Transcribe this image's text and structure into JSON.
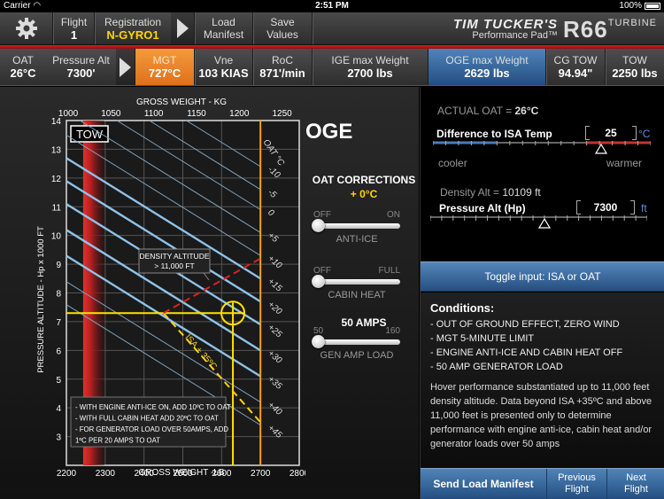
{
  "status_bar": {
    "carrier": "Carrier",
    "time": "2:51 PM",
    "battery": "100%"
  },
  "top_bar": {
    "flight_label": "Flight",
    "flight_value": "1",
    "registration_label": "Registration",
    "registration_value": "N-GYRO1",
    "load_manifest": "Load\nManifest",
    "save_values": "Save\nValues",
    "logo_line1": "TIM TUCKER'S",
    "logo_line2": "Performance Pad™",
    "logo_model": "R66",
    "logo_sup": "TURBINE"
  },
  "sub_bar": {
    "oat_label": "OAT",
    "oat_value": "26°C",
    "pa_label": "Pressure Alt",
    "pa_value": "7300'",
    "mgt_label": "MGT",
    "mgt_value": "727°C",
    "vne_label": "Vne",
    "vne_value": "103 KIAS",
    "roc_label": "RoC",
    "roc_value": "871'/min",
    "ige_label": "IGE max Weight",
    "ige_value": "2700 lbs",
    "oge_label": "OGE max Weight",
    "oge_value": "2629 lbs",
    "cg_label": "CG TOW",
    "cg_value": "94.94\"",
    "tow_label": "TOW",
    "tow_value": "2250 lbs"
  },
  "colors": {
    "mgt": "#f0882c",
    "oge": "#3a6ba0",
    "accent_yellow": "#ffd700",
    "red": "#d42222",
    "orange_line": "#f0a020"
  },
  "panel": {
    "title": "OGE",
    "oat_corrections_title": "OAT CORRECTIONS",
    "oat_corrections_value": "+ 0°C",
    "anti_ice": {
      "off": "OFF",
      "on": "ON",
      "name": "ANTI-ICE",
      "value": 0
    },
    "cabin_heat": {
      "off": "OFF",
      "on": "FULL",
      "name": "CABIN HEAT",
      "value": 0
    },
    "gen_amp": {
      "current": "50 AMPS",
      "min": "50",
      "max": "160",
      "name": "GEN AMP LOAD",
      "value": 50
    }
  },
  "right": {
    "actual_oat_label": "ACTUAL OAT = ",
    "actual_oat_value": "26°C",
    "isa_diff_label": "Difference to ISA Temp",
    "isa_diff_value": "25",
    "isa_diff_unit": "°C",
    "cooler": "cooler",
    "warmer": "warmer",
    "density_alt_label": "Density Alt = ",
    "density_alt_value": "10109 ft",
    "pa_label": "Pressure Alt (Hp)",
    "pa_value": "7300",
    "pa_unit": "ft",
    "toggle": "Toggle input: ISA or OAT",
    "conditions_title": "Conditions:",
    "conditions": [
      "- OUT OF GROUND EFFECT, ZERO WIND",
      "- MGT 5-MINUTE LIMIT",
      "- ENGINE ANTI-ICE AND CABIN HEAT OFF",
      "- 50 AMP GENERATOR LOAD"
    ],
    "note": "Hover performance substantiated up to 11,000 feet density altitude. Data beyond ISA +35ºC and above 11,000 feet is presented only to determine performance with engine anti-ice, cabin heat and/or generator loads over 50 amps",
    "send_manifest": "Send Load Manifest",
    "previous_flight": "Previous\nFlight",
    "next_flight": "Next\nFlight"
  },
  "chart_data": {
    "type": "line",
    "title": "OGE",
    "xlabel": "GROSS WEIGHT -LB",
    "x2label": "GROSS WEIGHT - KG",
    "ylabel": "PRESSURE ALTITUDE - Hp x 1000 FT",
    "xlim": [
      2200,
      2800
    ],
    "ylim": [
      2,
      14
    ],
    "x_ticks": [
      2200,
      2300,
      2400,
      2500,
      2600,
      2700,
      2800
    ],
    "x2_ticks": [
      1000,
      1050,
      1100,
      1150,
      1200,
      1250
    ],
    "y_ticks": [
      3,
      4,
      5,
      6,
      7,
      8,
      9,
      10,
      11,
      12,
      13,
      14
    ],
    "grid": true,
    "tow_label": "TOW",
    "tow_lb": 2250,
    "max_weight_lb": 2700,
    "result_weight_lb": 2629,
    "input_pa_kft": 7.3,
    "oat_axis_title": "OAT °C",
    "oat_lines": [
      {
        "label": "-10",
        "end_y": 12.4
      },
      {
        "label": "-5",
        "end_y": 11.6
      },
      {
        "label": "0",
        "end_y": 10.9
      },
      {
        "label": "+5",
        "end_y": 10.1
      },
      {
        "label": "+10",
        "end_y": 9.3
      },
      {
        "label": "+15",
        "end_y": 8.5
      },
      {
        "label": "+20",
        "end_y": 7.7
      },
      {
        "label": "+25",
        "end_y": 6.9
      },
      {
        "label": "+30",
        "end_y": 6.0
      },
      {
        "label": "+35",
        "end_y": 5.1
      },
      {
        "label": "+40",
        "end_y": 4.2
      },
      {
        "label": "+45",
        "end_y": 3.4
      }
    ],
    "annotations": {
      "density_altitude": "DENSITY ALTITUDE\n> 11,000 FT",
      "isa_line": "ISA + 35ºC",
      "notes": [
        "- WITH ENGINE ANTI-ICE ON, ADD 10ºC TO OAT",
        "- WITH FULL CABIN HEAT ADD 20ºC TO OAT",
        "- FOR GENERATOR LOAD OVER 50AMPS, ADD",
        "  1ºC PER 20 AMPS TO OAT"
      ]
    }
  }
}
